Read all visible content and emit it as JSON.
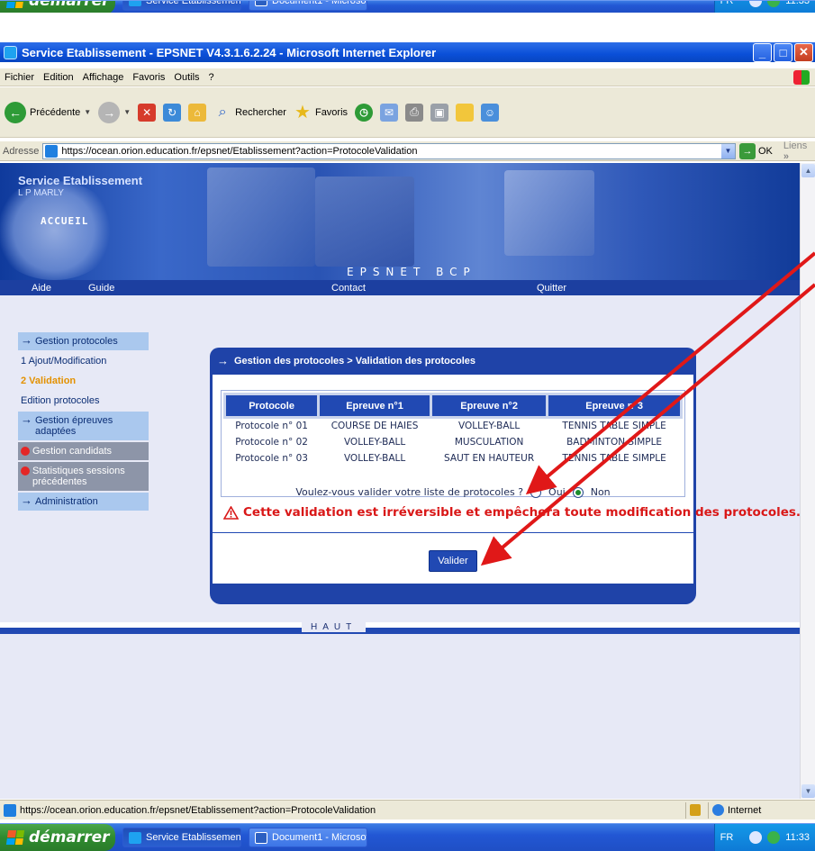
{
  "taskbar": {
    "start_label": "démarrer",
    "items": [
      {
        "label": "Service Etablissement..."
      },
      {
        "label": "Document1 - Microsof..."
      }
    ],
    "lang": "FR",
    "clock": "11:33"
  },
  "window": {
    "title": "Service Etablissement - EPSNET V4.3.1.6.2.24 - Microsoft Internet Explorer",
    "menu": [
      "Fichier",
      "Edition",
      "Affichage",
      "Favoris",
      "Outils",
      "?"
    ],
    "toolbar": {
      "back": "Précédente",
      "search": "Rechercher",
      "favorites": "Favoris"
    },
    "address_label": "Adresse",
    "address": "https://ocean.orion.education.fr/epsnet/Etablissement?action=ProtocoleValidation",
    "go_label": "OK",
    "links_label": "Liens",
    "links_chevron": "»"
  },
  "site": {
    "title": "Service Etablissement",
    "subtitle": "L P MARLY",
    "home_button": "ACCUEIL",
    "brand": "EPSNET BCP",
    "nav": {
      "aide": "Aide",
      "guide": "Guide",
      "contact": "Contact",
      "quitter": "Quitter"
    }
  },
  "sidebar": {
    "gestion_protocoles": "Gestion protocoles",
    "ajout": "1 Ajout/Modification",
    "validation": "2 Validation",
    "edition": "Edition protocoles",
    "gestion_epreuves": "Gestion épreuves adaptées",
    "gestion_candidats": "Gestion candidats",
    "statistiques": "Statistiques sessions précédentes",
    "administration": "Administration"
  },
  "panel": {
    "breadcrumb": "Gestion des protocoles > Validation des protocoles",
    "headers": [
      "Protocole",
      "Epreuve n°1",
      "Epreuve n°2",
      "Epreuve n°3"
    ],
    "rows": [
      [
        "Protocole n° 01",
        "COURSE DE HAIES",
        "VOLLEY-BALL",
        "TENNIS TABLE SIMPLE"
      ],
      [
        "Protocole n° 02",
        "VOLLEY-BALL",
        "MUSCULATION",
        "BADMINTON SIMPLE"
      ],
      [
        "Protocole n° 03",
        "VOLLEY-BALL",
        "SAUT EN HAUTEUR",
        "TENNIS TABLE SIMPLE"
      ]
    ],
    "question": "Voulez-vous valider votre liste de protocoles ?",
    "option_oui": "Oui",
    "option_non": "Non",
    "selected_option": "Non",
    "warning": "Cette validation est irréversible et empêchera toute modification des protocoles.",
    "submit": "Valider"
  },
  "footer_label": "HAUT",
  "statusbar": {
    "url": "https://ocean.orion.education.fr/epsnet/Etablissement?action=ProtocoleValidation",
    "zone": "Internet"
  },
  "colors": {
    "panel_blue": "#2149b3",
    "warning_red": "#d91818",
    "active_orange": "#e39100",
    "arrow_red": "#e01818"
  }
}
